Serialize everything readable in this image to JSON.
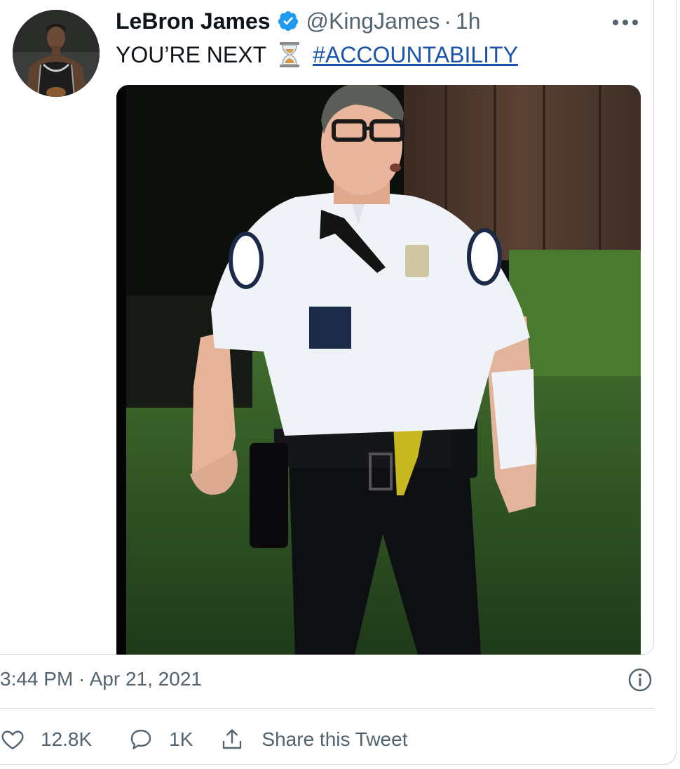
{
  "tweet": {
    "display_name": "LeBron James",
    "verified_icon": "verified-badge-icon",
    "handle": "@KingJames",
    "separator": "·",
    "relative_time": "1h",
    "more_icon": "more-options-icon",
    "text_before_emoji": "YOU’RE NEXT",
    "emoji_icon": "hourglass-icon",
    "hashtag": "#ACCOUNTABILITY",
    "timestamp": "3:44 PM · Apr 21, 2021",
    "info_icon": "info-icon"
  },
  "actions": {
    "like_count": "12.8K",
    "reply_count": "1K",
    "share_label": "Share this Tweet"
  },
  "colors": {
    "text_primary": "#0f1419",
    "text_secondary": "#536471",
    "verified_blue": "#1d9bf0",
    "link_blue": "#1a54a8",
    "border": "#cfd9de"
  }
}
